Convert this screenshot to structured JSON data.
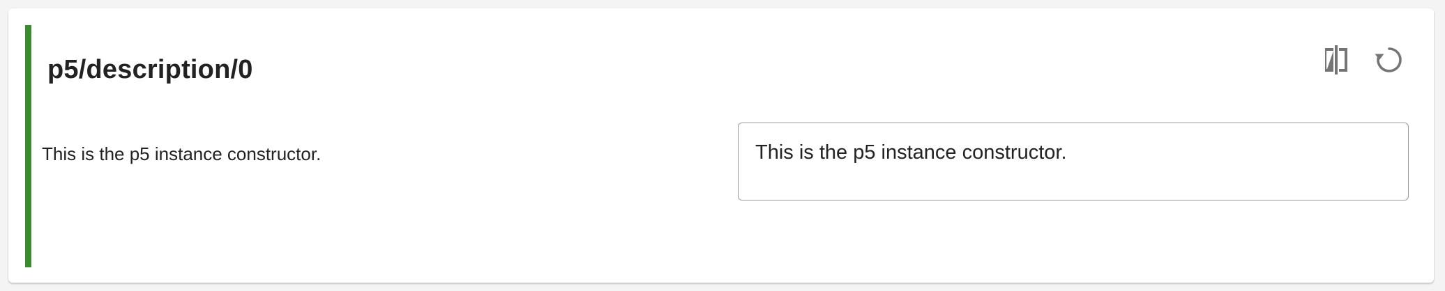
{
  "entry": {
    "key": "p5/description/0",
    "source_text": "This is the p5 instance constructor.",
    "translation_value": "This is the p5 instance constructor."
  },
  "toolbar": {
    "compare_icon": "compare-icon",
    "reset_icon": "restore-icon"
  },
  "colors": {
    "accent": "#3a8a2e",
    "icon": "#757575"
  }
}
